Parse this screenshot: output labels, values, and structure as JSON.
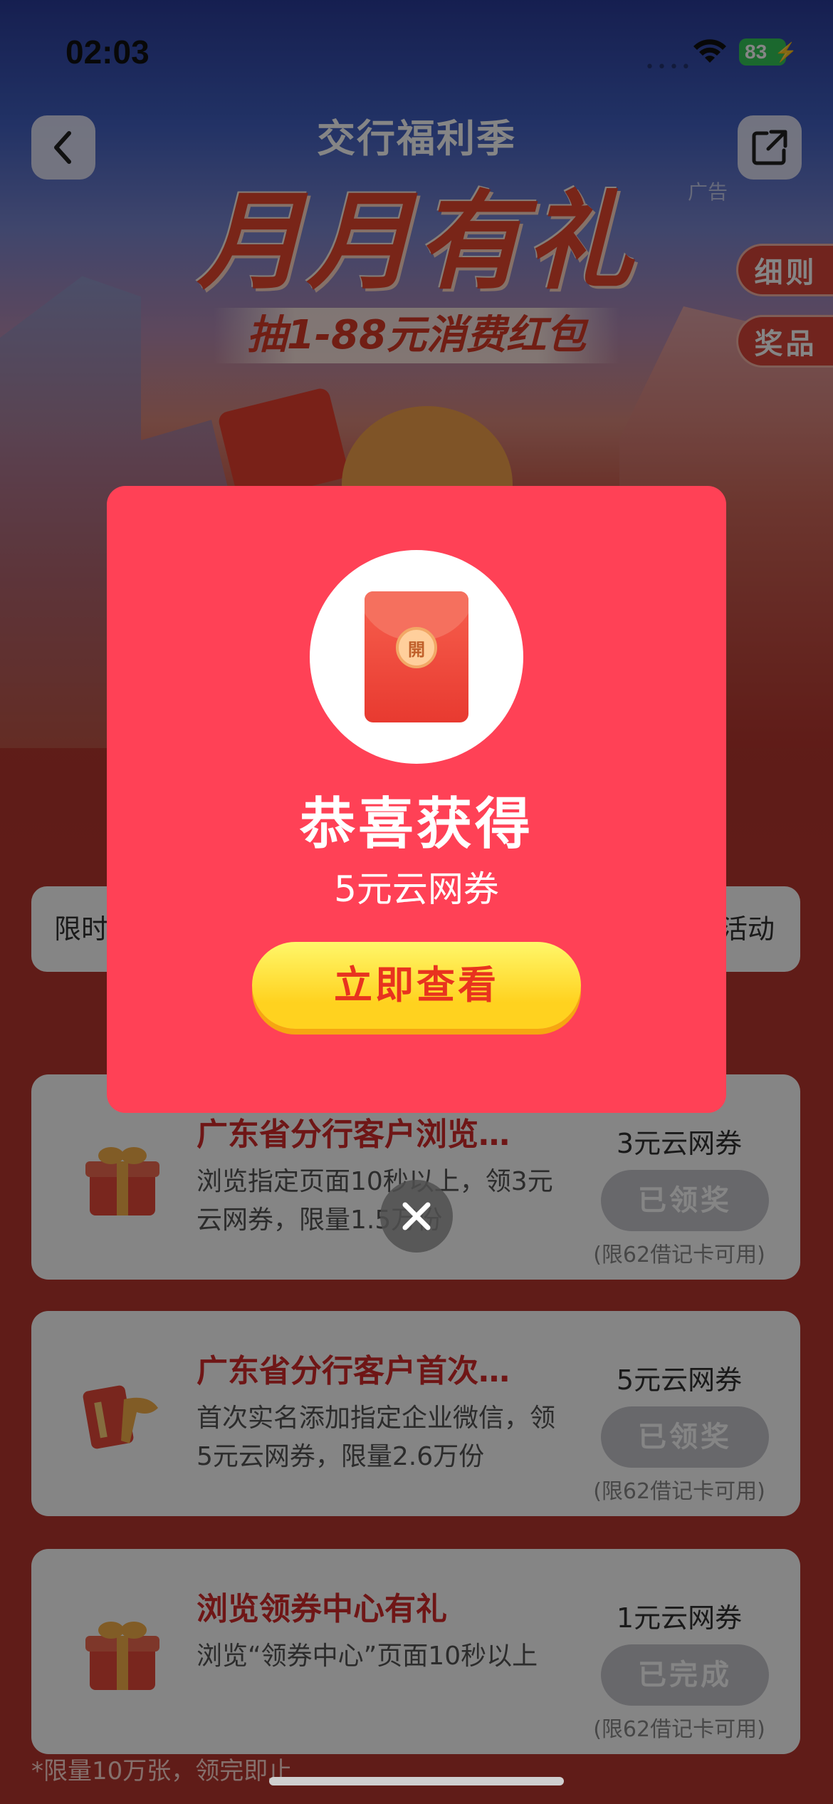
{
  "status_bar": {
    "time": "02:03",
    "battery": "83"
  },
  "header": {
    "brand": "交行福利季",
    "title": "月月有礼",
    "subtitle": "抽1-88元消费红包",
    "ad_label": "广告",
    "rules_label": "细则",
    "prizes_label": "奖品"
  },
  "tabs": {
    "left_label": "限时",
    "right_label": "活动"
  },
  "tasks": [
    {
      "title": "广东省分行客户浏览…",
      "desc": "浏览指定页面10秒以上，领3元云网券，限量1.5万份",
      "reward": "3元云网券",
      "button": "已领奖",
      "note": "(限62借记卡可用)",
      "icon": "gift-box-icon"
    },
    {
      "title": "广东省分行客户首次…",
      "desc": "首次实名添加指定企业微信，领5元云网券，限量2.6万份",
      "reward": "5元云网券",
      "button": "已领奖",
      "note": "(限62借记卡可用)",
      "icon": "card-icon"
    },
    {
      "title": "浏览领券中心有礼",
      "desc": "浏览“领券中心”页面10秒以上",
      "reward": "1元云网券",
      "button": "已完成",
      "note": "(限62借记卡可用)",
      "icon": "gift-box-icon"
    }
  ],
  "footnote": "*限量10万张，领完即止",
  "modal": {
    "envelope_seal": "開",
    "title": "恭喜获得",
    "subtitle": "5元云网券",
    "button": "立即查看"
  },
  "colors": {
    "modal_bg": "#ff4156",
    "button_yellow": "#ffd21f",
    "accent_red": "#d52b2b",
    "page_bg": "#b8362e"
  }
}
